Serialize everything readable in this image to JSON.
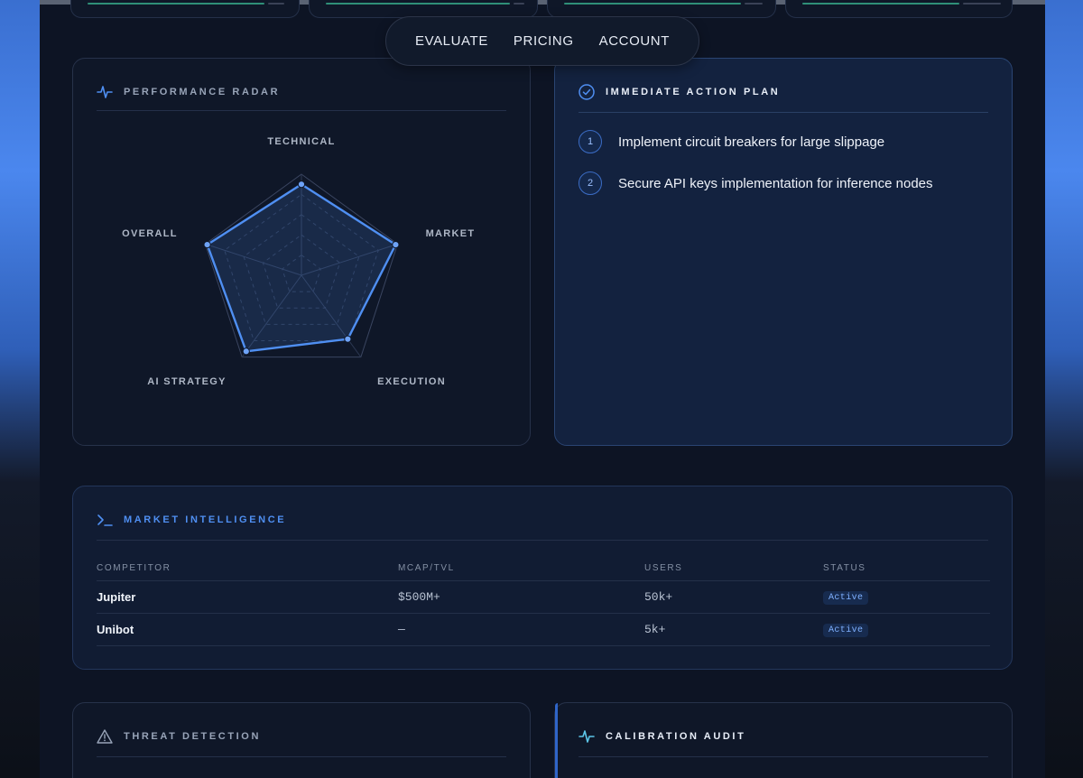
{
  "nav": {
    "items": [
      "EVALUATE",
      "PRICING",
      "ACCOUNT"
    ]
  },
  "radar": {
    "title": "PERFORMANCE RADAR",
    "axes": [
      "TECHNICAL",
      "MARKET",
      "EXECUTION",
      "AI STRATEGY",
      "OVERALL"
    ],
    "values": [
      0.9,
      0.98,
      0.78,
      0.93,
      0.98
    ],
    "color": "#4f8ff2"
  },
  "action_plan": {
    "title": "IMMEDIATE ACTION PLAN",
    "items": [
      {
        "num": "1",
        "text": "Implement circuit breakers for large slippage"
      },
      {
        "num": "2",
        "text": "Secure API keys implementation for inference nodes"
      }
    ]
  },
  "market": {
    "title": "MARKET INTELLIGENCE",
    "columns": [
      "COMPETITOR",
      "MCAP/TVL",
      "USERS",
      "STATUS"
    ],
    "rows": [
      {
        "competitor": "Jupiter",
        "mcap": "$500M+",
        "users": "50k+",
        "status": "Active"
      },
      {
        "competitor": "Unibot",
        "mcap": "—",
        "users": "5k+",
        "status": "Active"
      }
    ]
  },
  "threat": {
    "title": "THREAT DETECTION"
  },
  "calibration": {
    "title": "CALIBRATION AUDIT"
  },
  "colors": {
    "accent": "#4f8ff2",
    "status_green": "#2f8f78",
    "panel": "#0f1728"
  }
}
